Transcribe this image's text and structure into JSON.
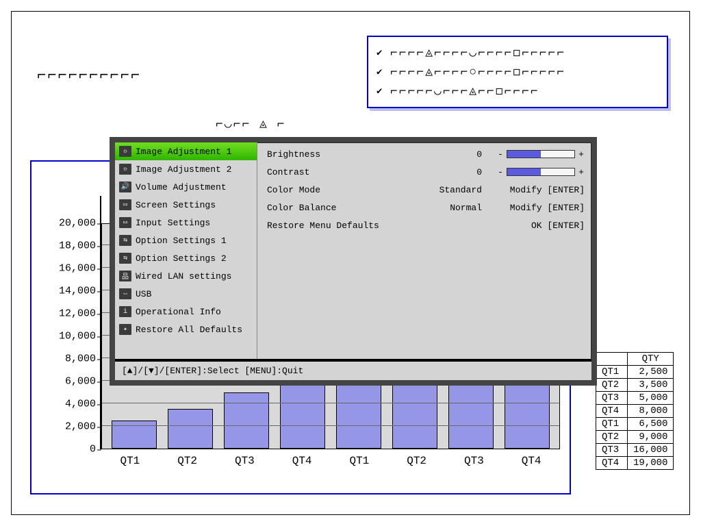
{
  "glyphs": {
    "row1": "⌐⌐⌐⌐⌐⌐⌐⌐⌐⌐",
    "row2": "⌐◡⌐⌐ ◬ ⌐"
  },
  "checks": {
    "row1": "⌐⌐⌐⌐◬⌐⌐⌐⌐◡⌐⌐⌐⌐◻⌐⌐⌐⌐⌐",
    "row2": "⌐⌐⌐⌐◬⌐⌐⌐⌐○⌐⌐⌐⌐◻⌐⌐⌐⌐⌐",
    "row3": "⌐⌐⌐⌐⌐◡⌐⌐⌐◬⌐⌐◻⌐⌐⌐⌐"
  },
  "chart_data": {
    "type": "bar",
    "categories": [
      "QT1",
      "QT2",
      "QT3",
      "QT4",
      "QT1",
      "QT2",
      "QT3",
      "QT4"
    ],
    "values": [
      2500,
      3500,
      5000,
      8000,
      6500,
      9000,
      16000,
      19000
    ],
    "ylabel": "",
    "ylim": [
      0,
      20000
    ],
    "yticks": [
      0,
      2000,
      4000,
      6000,
      8000,
      10000,
      12000,
      14000,
      16000,
      18000,
      20000
    ],
    "bar_color": "#9696e6"
  },
  "yticks_labels": [
    "20,000",
    "18,000",
    "16,000",
    "14,000",
    "12,000",
    "10,000",
    "8,000",
    "6,000",
    "4,000",
    "2,000",
    "0"
  ],
  "table": {
    "header": "QTY",
    "rows": [
      {
        "label": "QT1",
        "value": "2,500"
      },
      {
        "label": "QT2",
        "value": "3,500"
      },
      {
        "label": "QT3",
        "value": "5,000"
      },
      {
        "label": "QT4",
        "value": "8,000"
      },
      {
        "label": "QT1",
        "value": "6,500"
      },
      {
        "label": "QT2",
        "value": "9,000"
      },
      {
        "label": "QT3",
        "value": "16,000"
      },
      {
        "label": "QT4",
        "value": "19,000"
      }
    ]
  },
  "osd": {
    "sidebar": [
      {
        "icon": "☼",
        "label": "Image Adjustment 1",
        "selected": true
      },
      {
        "icon": "☼",
        "label": "Image Adjustment 2"
      },
      {
        "icon": "🔊",
        "label": "Volume Adjustment"
      },
      {
        "icon": "▭",
        "label": "Screen Settings"
      },
      {
        "icon": "▭",
        "label": "Input Settings"
      },
      {
        "icon": "⇆",
        "label": "Option Settings 1"
      },
      {
        "icon": "⇆",
        "label": "Option Settings 2"
      },
      {
        "icon": "品",
        "label": "Wired LAN settings"
      },
      {
        "icon": "⇔",
        "label": "USB"
      },
      {
        "icon": "i",
        "label": "Operational Info"
      },
      {
        "icon": "✦",
        "label": "Restore All Defaults"
      }
    ],
    "pane": {
      "brightness": {
        "label": "Brightness",
        "value": "0",
        "fill_pct": 50
      },
      "contrast": {
        "label": "Contrast",
        "value": "0",
        "fill_pct": 50
      },
      "color_mode": {
        "label": "Color Mode",
        "value": "Standard",
        "action": "Modify [ENTER]"
      },
      "color_bal": {
        "label": "Color Balance",
        "value": "Normal",
        "action": "Modify [ENTER]"
      },
      "restore": {
        "label": "Restore Menu Defaults",
        "action": "OK [ENTER]"
      }
    },
    "hint": "[▲]/[▼]/[ENTER]:Select  [MENU]:Quit"
  }
}
